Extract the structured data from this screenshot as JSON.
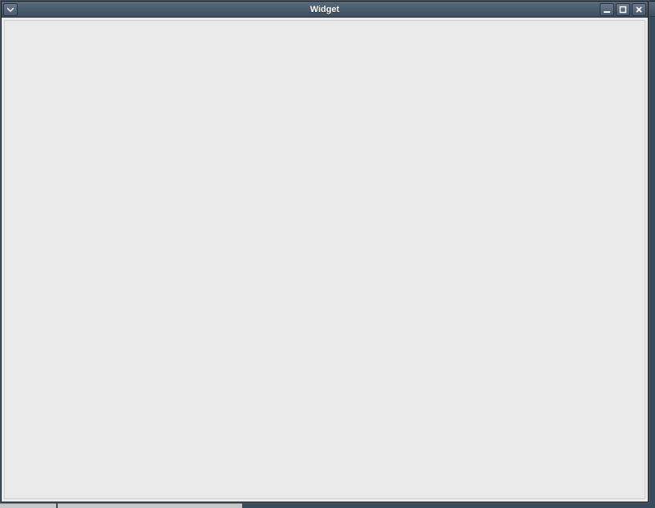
{
  "window": {
    "title": "Widget"
  }
}
